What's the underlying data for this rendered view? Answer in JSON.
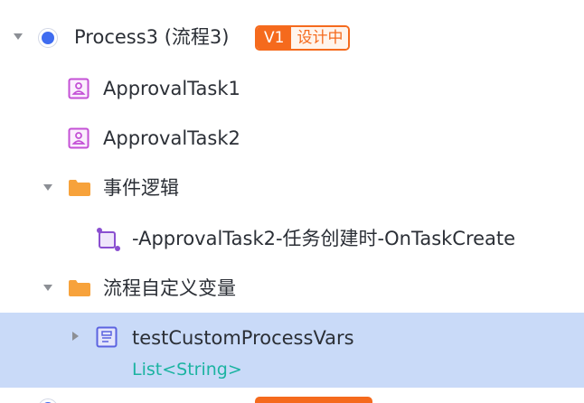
{
  "tree": {
    "process": {
      "name": "Process3 (流程3)",
      "version": "V1",
      "status": "设计中"
    },
    "tasks": [
      {
        "label": "ApprovalTask1"
      },
      {
        "label": "ApprovalTask2"
      }
    ],
    "event_folder": {
      "label": "事件逻辑",
      "items": [
        {
          "label": "-ApprovalTask2-任务创建时-OnTaskCreate"
        }
      ]
    },
    "vars_folder": {
      "label": "流程自定义变量",
      "items": [
        {
          "label": "testCustomProcessVars",
          "type": "List<String>"
        }
      ]
    }
  },
  "colors": {
    "accent_orange": "#f56a1d",
    "process_blue": "#3f6cf0",
    "selected_row": "#c9daf8",
    "type_teal": "#1bb3a1",
    "task_icon": "#c451d6",
    "folder": "#f7a23b",
    "event_icon": "#8a4fd0",
    "var_icon": "#5b63e0"
  },
  "icons": [
    "caret-down-icon",
    "process-icon",
    "user-task-icon",
    "folder-icon",
    "event-icon",
    "variable-icon",
    "caret-right-icon"
  ]
}
